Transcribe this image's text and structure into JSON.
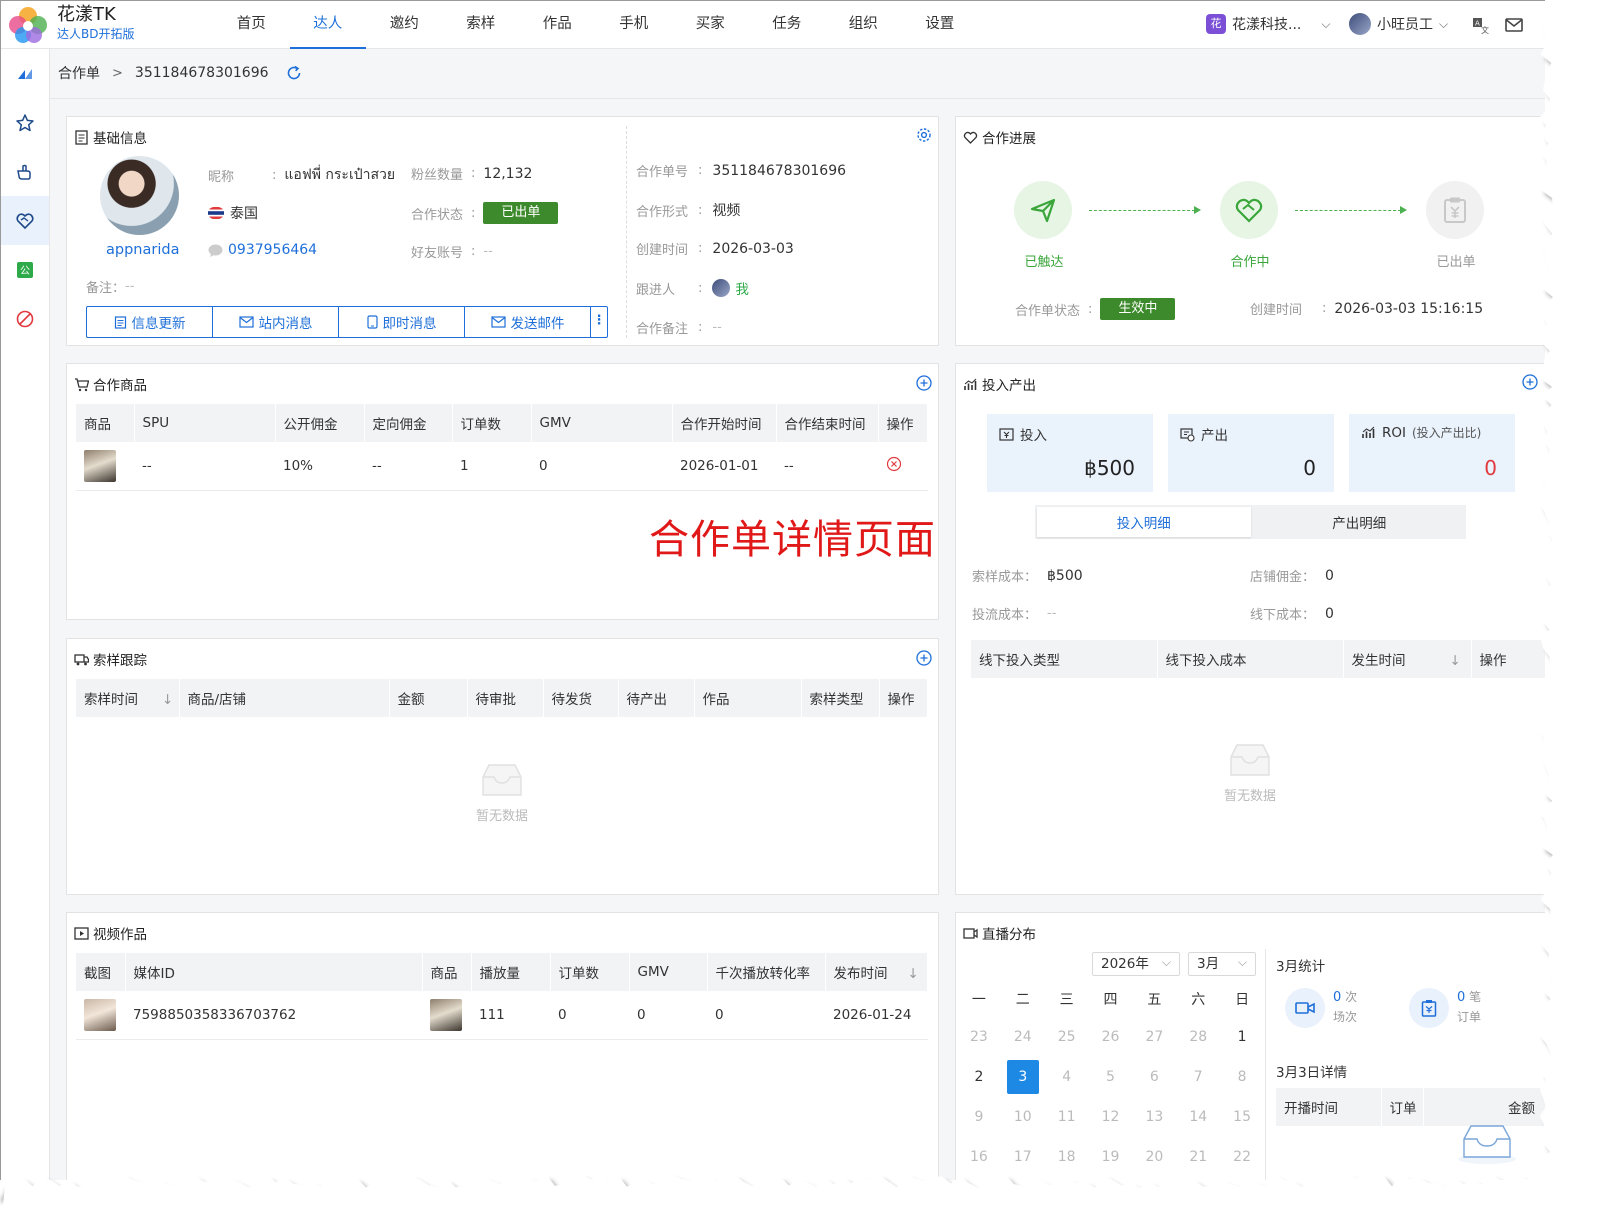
{
  "app": {
    "name": "花漾TK",
    "subtitle": "达人BD开拓版"
  },
  "nav": [
    "首页",
    "达人",
    "邀约",
    "索样",
    "作品",
    "手机",
    "买家",
    "任务",
    "组织",
    "设置"
  ],
  "nav_active_index": 1,
  "org": {
    "badge": "花",
    "name": "花漾科技..."
  },
  "user": {
    "name": "小旺员工"
  },
  "breadcrumb": {
    "root": "合作单",
    "current": "351184678301696"
  },
  "basic": {
    "title": "基础信息",
    "username": "appnarida",
    "nickname_label": "昵称",
    "nickname": "แอฟพี่ กระเป๋าสวย",
    "fans_label": "粉丝数量",
    "fans": "12,132",
    "country": "泰国",
    "status_label": "合作状态",
    "status": "已出单",
    "phone": "0937956464",
    "friend_label": "好友账号",
    "friend": "--",
    "remark_label": "备注：",
    "remark": "--",
    "order_no_label": "合作单号",
    "order_no": "351184678301696",
    "form_label": "合作形式",
    "form": "视频",
    "created_label": "创建时间",
    "created": "2026-03-03",
    "follower_label": "跟进人",
    "follower": "我",
    "coop_remark_label": "合作备注",
    "coop_remark": "--",
    "buttons": [
      "信息更新",
      "站内消息",
      "即时消息",
      "发送邮件"
    ]
  },
  "progress": {
    "title": "合作进展",
    "steps": [
      "已触达",
      "合作中",
      "已出单"
    ],
    "status_label": "合作单状态",
    "status": "生效中",
    "created_label": "创建时间",
    "created": "2026-03-03 15:16:15"
  },
  "products": {
    "title": "合作商品",
    "headers": [
      "商品",
      "SPU",
      "公开佣金",
      "定向佣金",
      "订单数",
      "GMV",
      "合作开始时间",
      "合作结束时间",
      "操作"
    ],
    "rows": [
      {
        "spu": "--",
        "commission": "10%",
        "targeted": "--",
        "orders": "1",
        "gmv": "0",
        "start": "2026-01-01",
        "end": "--"
      }
    ]
  },
  "watermark": "合作单详情页面",
  "samples": {
    "title": "索样跟踪",
    "headers": [
      "索样时间",
      "商品/店铺",
      "金额",
      "待审批",
      "待发货",
      "待产出",
      "作品",
      "索样类型",
      "操作"
    ],
    "empty": "暂无数据"
  },
  "io": {
    "title": "投入产出",
    "input_label": "投入",
    "input_value": "฿500",
    "output_label": "产出",
    "output_value": "0",
    "roi_label": "ROI",
    "roi_sub": "(投入产出比)",
    "roi_value": "0",
    "tabs": [
      "投入明细",
      "产出明细"
    ],
    "sample_cost_label": "索样成本：",
    "sample_cost": "฿500",
    "shop_comm_label": "店铺佣金：",
    "shop_comm": "0",
    "traffic_cost_label": "投流成本：",
    "traffic_cost": "--",
    "offline_cost_label": "线下成本：",
    "offline_cost": "0",
    "headers": [
      "线下投入类型",
      "线下投入成本",
      "发生时间",
      "操作"
    ],
    "empty": "暂无数据"
  },
  "videos": {
    "title": "视频作品",
    "headers": [
      "截图",
      "媒体ID",
      "商品",
      "播放量",
      "订单数",
      "GMV",
      "千次播放转化率",
      "发布时间"
    ],
    "rows": [
      {
        "media_id": "7598850358336703762",
        "plays": "111",
        "orders": "0",
        "gmv": "0",
        "rate": "0",
        "published": "2026-01-24"
      }
    ]
  },
  "live": {
    "title": "直播分布",
    "year": "2026年",
    "month": "3月",
    "weekdays": [
      "一",
      "二",
      "三",
      "四",
      "五",
      "六",
      "日"
    ],
    "weeks": [
      [
        "23",
        "24",
        "25",
        "26",
        "27",
        "28",
        "1"
      ],
      [
        "2",
        "3",
        "4",
        "5",
        "6",
        "7",
        "8"
      ],
      [
        "9",
        "10",
        "11",
        "12",
        "13",
        "14",
        "15"
      ],
      [
        "16",
        "17",
        "18",
        "19",
        "20",
        "21",
        "22"
      ]
    ],
    "today": "3",
    "stats_title": "3月统计",
    "sessions": "0",
    "sessions_unit": "次",
    "sessions_label": "场次",
    "orders": "0",
    "orders_unit": "笔",
    "orders_label": "订单",
    "detail_title": "3月3日详情",
    "detail_headers": [
      "开播时间",
      "订单",
      "金额"
    ]
  },
  "colors": {
    "accent": "#1e6fd9",
    "green": "#3d8a2c",
    "red": "#e01818"
  }
}
